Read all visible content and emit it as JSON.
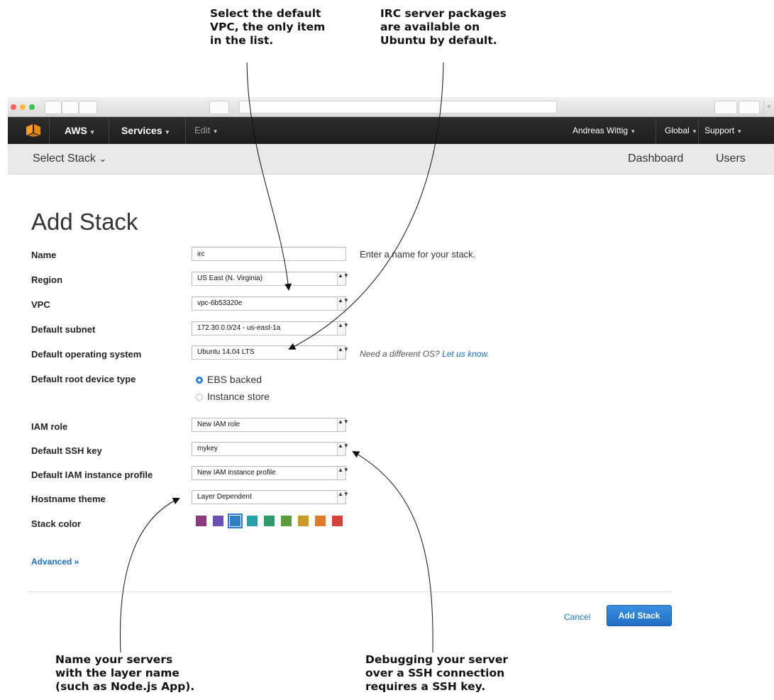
{
  "callouts": {
    "top_left": [
      "Select the default",
      "VPC, the only item",
      "in the list."
    ],
    "top_right": [
      "IRC server packages",
      "are available on",
      "Ubuntu by default."
    ],
    "bottom_left": [
      "Name your servers",
      "with the layer name",
      "(such as Node.js App)."
    ],
    "bottom_right": [
      "Debugging your server",
      "over a SSH connection",
      "requires a SSH key."
    ]
  },
  "topbar": {
    "aws": "AWS",
    "services": "Services",
    "edit": "Edit",
    "user": "Andreas Wittig",
    "region": "Global",
    "support": "Support",
    "caret": "▾"
  },
  "subnav": {
    "select_stack": "Select Stack",
    "dashboard": "Dashboard",
    "users": "Users",
    "caret": "⌄"
  },
  "page": {
    "title": "Add Stack"
  },
  "form": {
    "name": {
      "label": "Name",
      "value": "irc",
      "hint": "Enter a name for your stack."
    },
    "region": {
      "label": "Region",
      "value": "US East (N. Virginia)"
    },
    "vpc": {
      "label": "VPC",
      "value": "vpc-6b53320e"
    },
    "subnet": {
      "label": "Default subnet",
      "value": "172.30.0.0/24 - us-east-1a"
    },
    "os": {
      "label": "Default operating system",
      "value": "Ubuntu 14.04 LTS",
      "hint": "Need a different OS?",
      "hint_link": "Let us know."
    },
    "root_device": {
      "label": "Default root device type",
      "option_ebs": "EBS backed",
      "option_instance": "Instance store"
    },
    "iam_role": {
      "label": "IAM role",
      "value": "New IAM role"
    },
    "ssh_key": {
      "label": "Default SSH key",
      "value": "mykey"
    },
    "instance_profile": {
      "label": "Default IAM instance profile",
      "value": "New IAM instance profile"
    },
    "hostname": {
      "label": "Hostname theme",
      "value": "Layer Dependent"
    },
    "stack_color": {
      "label": "Stack color",
      "colors": [
        "#8e3a7a",
        "#6a4fb0",
        "#2f7fc1",
        "#27a0a8",
        "#2e9a6a",
        "#5c9a3a",
        "#c99a2a",
        "#e07a28",
        "#d0453a"
      ],
      "selected_index": 2
    }
  },
  "advanced": "Advanced »",
  "footer": {
    "cancel": "Cancel",
    "submit": "Add Stack"
  },
  "select_arrows": "▲▼",
  "colors": {
    "accent": "#2a7bd1",
    "topbar": "#232323",
    "link": "#1a6fc9"
  }
}
